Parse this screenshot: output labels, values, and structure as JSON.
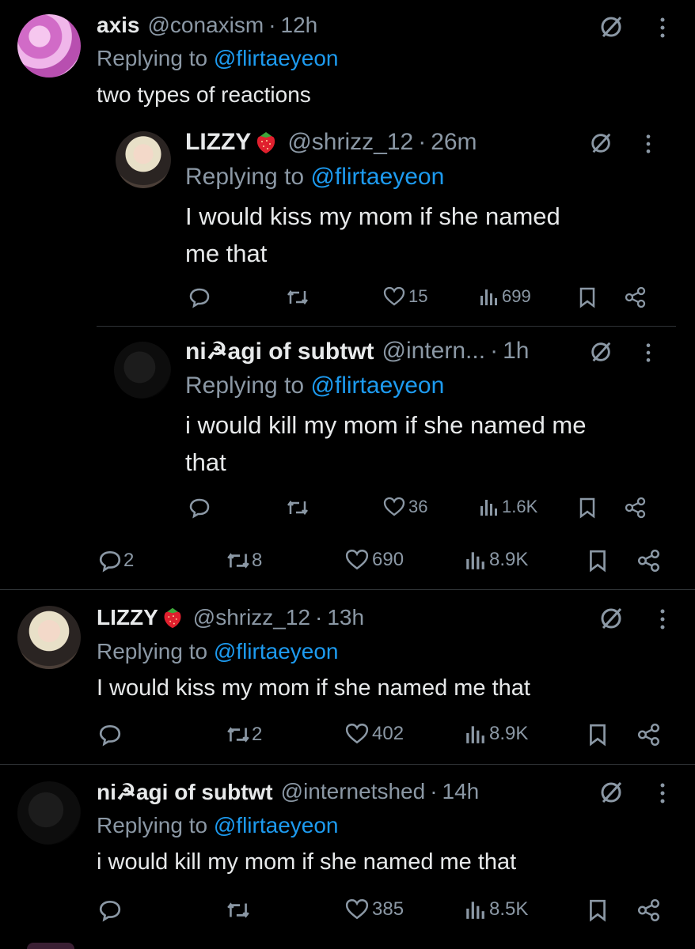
{
  "tweets": [
    {
      "name": "axis",
      "handle": "@conaxism",
      "sep": "·",
      "time": "12h",
      "replying_prefix": "Replying to ",
      "replying_to": "@flirtaeyeon",
      "text": "two types of reactions",
      "actions": {
        "replies": "2",
        "retweets": "8",
        "likes": "690",
        "views": "8.9K"
      }
    },
    {
      "name": "LIZZY",
      "handle": "@shrizz_12",
      "sep": "·",
      "time": "13h",
      "replying_prefix": "Replying to ",
      "replying_to": "@flirtaeyeon",
      "text": "I would kiss my mom if she named me that",
      "actions": {
        "replies": "",
        "retweets": "2",
        "likes": "402",
        "views": "8.9K"
      }
    },
    {
      "name": "ni☭agi of subtwt",
      "handle": "@internetshed",
      "sep": "·",
      "time": "14h",
      "replying_prefix": "Replying to ",
      "replying_to": "@flirtaeyeon",
      "text": "i would kill my mom if she named me that",
      "actions": {
        "replies": "",
        "retweets": "",
        "likes": "385",
        "views": "8.5K"
      }
    }
  ],
  "quoted": [
    {
      "name": "LIZZY",
      "handle": "@shrizz_12",
      "sep": "·",
      "time": "26m",
      "replying_prefix": "Replying to ",
      "replying_to": "@flirtaeyeon",
      "text_line1": "I would kiss my mom if she named",
      "text_line2": "me that",
      "actions": {
        "likes": "15",
        "views": "699"
      }
    },
    {
      "name": "ni☭agi of subtwt",
      "handle": "@intern...",
      "sep": "·",
      "time": "1h",
      "replying_prefix": "Replying to ",
      "replying_to": "@flirtaeyeon",
      "text_line1": "i would kill my mom if she named me",
      "text_line2": "that",
      "actions": {
        "likes": "36",
        "views": "1.6K"
      }
    }
  ],
  "icons": {
    "name_emoji": "strawberry-icon",
    "grok": "grok-slash-icon",
    "more": "more-vertical-icon",
    "reply": "reply-bubble-icon",
    "retweet": "retweet-icon",
    "like": "heart-icon",
    "views": "views-bars-icon",
    "bookmark": "bookmark-icon",
    "share": "share-icon"
  },
  "colors": {
    "background": "#000000",
    "text": "#e7e9ea",
    "muted": "#8b98a5",
    "link": "#1d9bf0",
    "divider": "#2f3336"
  }
}
